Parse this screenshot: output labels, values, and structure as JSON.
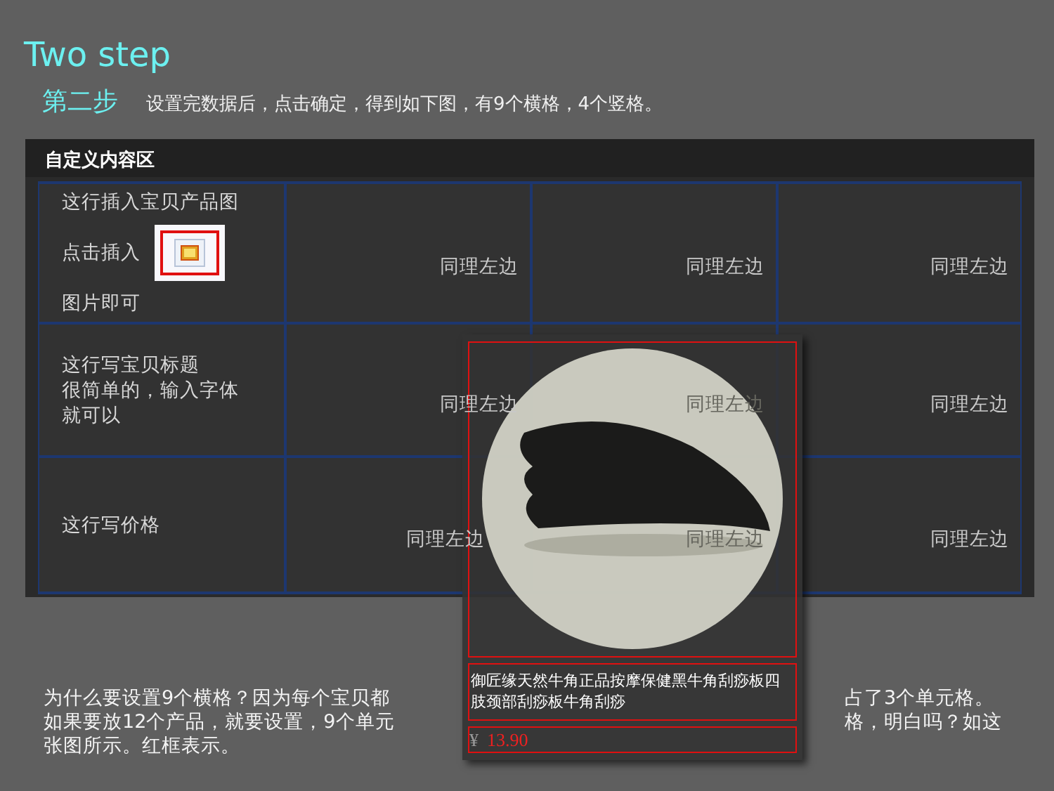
{
  "title": "Two step",
  "step": {
    "label": "第二步",
    "text": "设置完数据后，点击确定，得到如下图，有9个横格，4个竖格。"
  },
  "panel": {
    "header": "自定义内容区",
    "rows": [
      {
        "kind": "image",
        "lines": [
          "这行插入宝贝产品图",
          "点击插入",
          "图片即可"
        ],
        "cells": [
          "同理左边",
          "同理左边",
          "同理左边"
        ]
      },
      {
        "kind": "text",
        "lines": [
          "这行写宝贝标题",
          "很简单的，输入字体",
          "就可以"
        ],
        "cells": [
          "同理左边",
          "同理左边",
          "同理左边"
        ]
      },
      {
        "kind": "text",
        "lines": [
          "这行写价格"
        ],
        "cells": [
          "同理左边",
          "同理左边",
          "同理左边"
        ]
      }
    ]
  },
  "card": {
    "title": "御匠缘天然牛角正品按摩保健黑牛角刮痧板四肢颈部刮痧板牛角刮痧",
    "currency": "¥",
    "price": "13.90"
  },
  "note": {
    "left_lines": [
      "为什么要设置9个横格？因为每个宝贝都",
      "如果要放12个产品，就要设置，9个单元",
      "张图所示。红框表示。"
    ],
    "right_lines": [
      "占了3个单元格。",
      "格，明白吗？如这"
    ]
  }
}
